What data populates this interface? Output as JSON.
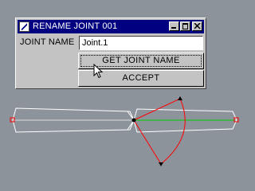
{
  "window": {
    "title": "RENAME JOINT 001",
    "field_label": "JOINT NAME",
    "field_value": "Joint.1",
    "get_button": "GET JOINT NAME",
    "accept_button": "ACCEPT"
  },
  "icons": [
    "app-icon",
    "minimize-icon",
    "maximize-icon",
    "close-icon",
    "mouse-cursor-icon"
  ],
  "colors": {
    "desktop": "#8d939b",
    "window": "#c3c3c3",
    "titlebar": "#000080",
    "bone_outline": "#ffffff",
    "rotation_arc": "#ff0000",
    "axis_line": "#00cc00"
  }
}
